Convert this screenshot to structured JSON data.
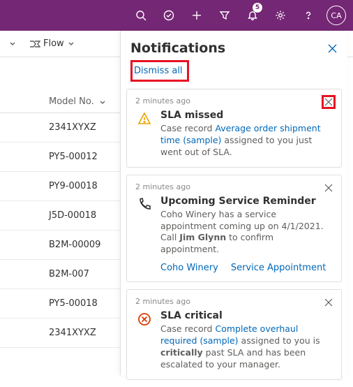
{
  "header": {
    "notification_count": "5",
    "avatar_initials": "CA"
  },
  "toolbar": {
    "flow_label": "Flow"
  },
  "grid": {
    "column_label": "Model No.",
    "rows": [
      "2341XYXZ",
      "PY5-00012",
      "PY9-00018",
      "J5D-00018",
      "B2M-00009",
      "B2M-007",
      "PY5-00018",
      "2341XYXZ"
    ]
  },
  "panel": {
    "title": "Notifications",
    "dismiss_all": "Dismiss all"
  },
  "cards": [
    {
      "timestamp": "2 minutes ago",
      "title": "SLA missed",
      "msg_pre": "Case record ",
      "link": "Average order shipment time (sample)",
      "msg_post": " assigned to you just went out of SLA."
    },
    {
      "timestamp": "2 minutes ago",
      "title": "Upcoming Service Reminder",
      "msg_pre": "Coho Winery has a service appointment coming up on 4/1/2021. Call ",
      "bold": "Jim Glynn",
      "msg_post": " to confirm appointment.",
      "action1": "Coho Winery",
      "action2": "Service Appointment"
    },
    {
      "timestamp": "2 minutes ago",
      "title": "SLA critical",
      "msg_pre": "Case record ",
      "link": "Complete overhaul required (sample)",
      "msg_mid": " assigned to you is ",
      "bold": "critically",
      "msg_post": " past SLA and has been escalated to your manager."
    }
  ]
}
